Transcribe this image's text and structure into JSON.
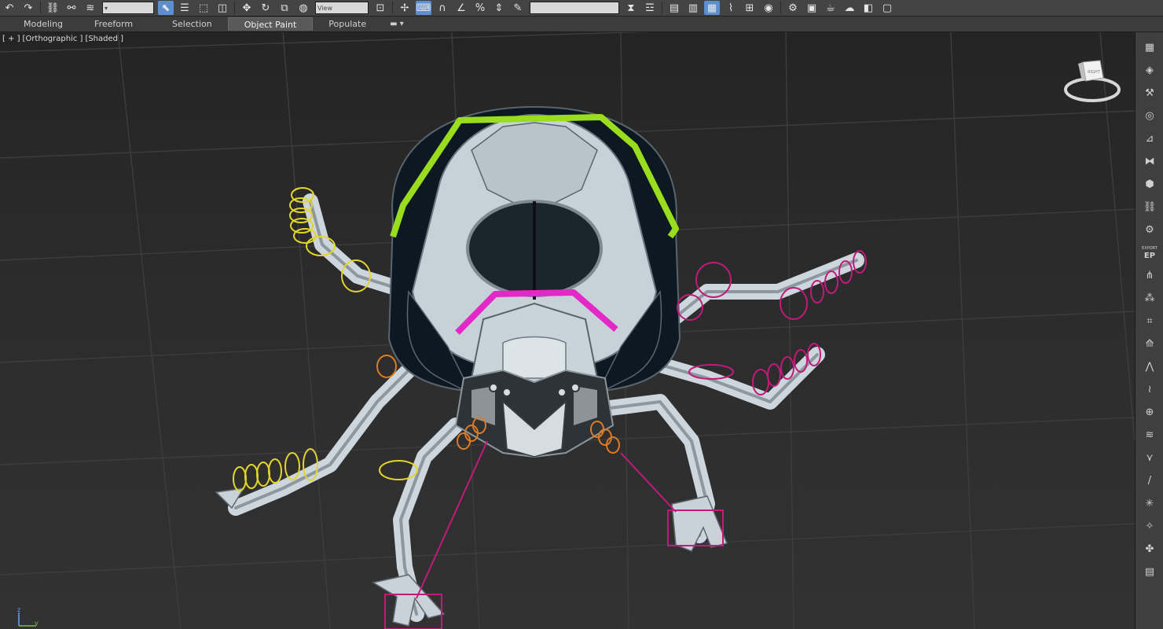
{
  "toolbar": {
    "layer_field": "▾",
    "selection_set_field": "",
    "viewport_dropdown": "View"
  },
  "ribbon": {
    "tabs": [
      "Modeling",
      "Freeform",
      "Selection",
      "Object Paint",
      "Populate"
    ],
    "active_tab": "Object Paint",
    "extra_control": "▾"
  },
  "viewport": {
    "label_plus": "[ + ]",
    "label_view": "[Orthographic ]",
    "label_shading": "[Shaded ]",
    "viewcube_face": "RIGHT",
    "axis_z": "z",
    "axis_y": "y"
  },
  "command_panel": {
    "ep_label": "EP",
    "ep_caption": "EXPORT"
  },
  "colors": {
    "head_controller": "#9adc1e",
    "mouth_controller": "#e428c8",
    "left_leg_controller": "#e3d62a",
    "right_leg_controller": "#c01a7a",
    "mid_leg_controller": "#e07a20",
    "grid": "#3b3b3b",
    "active_button": "#5b8fd0"
  }
}
